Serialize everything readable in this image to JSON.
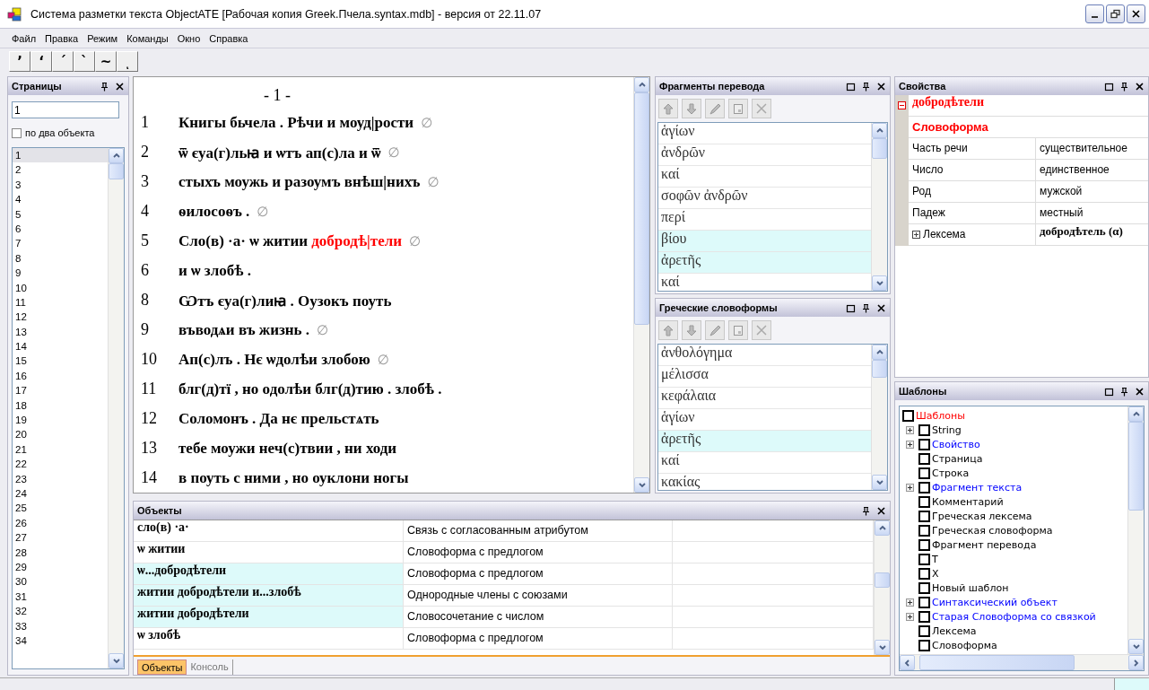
{
  "window": {
    "title": "Система разметки текста ObjectATE [Рабочая копия Greek.Пчела.syntax.mdb] -  версия от 22.11.07"
  },
  "menu": [
    "Файл",
    "Правка",
    "Режим",
    "Команды",
    "Окно",
    "Справка"
  ],
  "toolbar": [
    "’",
    "‘",
    "ˊ",
    "ˋ",
    "~",
    "ͺ"
  ],
  "pages_panel": {
    "title": "Страницы",
    "page_field": "1",
    "two_objects": {
      "label": "по два объекта",
      "checked": false
    },
    "pages": [
      {
        "label": "1",
        "selected": true
      },
      {
        "label": "2",
        "selected": false
      },
      {
        "label": "3",
        "selected": false
      },
      {
        "label": "4",
        "selected": false
      },
      {
        "label": "5",
        "selected": false
      },
      {
        "label": "6",
        "selected": false
      },
      {
        "label": "7",
        "selected": false
      },
      {
        "label": "8",
        "selected": false
      },
      {
        "label": "9",
        "selected": false
      },
      {
        "label": "10",
        "selected": false
      },
      {
        "label": "11",
        "selected": false
      },
      {
        "label": "12",
        "selected": false
      },
      {
        "label": "13",
        "selected": false
      },
      {
        "label": "14",
        "selected": false
      },
      {
        "label": "15",
        "selected": false
      },
      {
        "label": "16",
        "selected": false
      },
      {
        "label": "17",
        "selected": false
      },
      {
        "label": "18",
        "selected": false
      },
      {
        "label": "19",
        "selected": false
      },
      {
        "label": "20",
        "selected": false
      },
      {
        "label": "21",
        "selected": false
      },
      {
        "label": "22",
        "selected": false
      },
      {
        "label": "23",
        "selected": false
      },
      {
        "label": "24",
        "selected": false
      },
      {
        "label": "25",
        "selected": false
      },
      {
        "label": "26",
        "selected": false
      },
      {
        "label": "27",
        "selected": false
      },
      {
        "label": "28",
        "selected": false
      },
      {
        "label": "29",
        "selected": false
      },
      {
        "label": "30",
        "selected": false
      },
      {
        "label": "31",
        "selected": false
      },
      {
        "label": "32",
        "selected": false
      },
      {
        "label": "33",
        "selected": false
      },
      {
        "label": "34",
        "selected": false
      }
    ]
  },
  "document": {
    "page_heading": "- 1 -",
    "lines": [
      {
        "number": "1",
        "segments": [
          {
            "text": "Книгы бьчела . Рѣчи и моуд|рости",
            "highlighted": false
          }
        ],
        "mark": "∅"
      },
      {
        "number": "2",
        "segments": [
          {
            "text": "ѿ єуа(г)льꙗ и ѡтъ ап(с)ла и ѿ",
            "highlighted": false
          }
        ],
        "mark": "∅"
      },
      {
        "number": "3",
        "segments": [
          {
            "text": "стыхъ моужь и разоумъ внѣш|нихъ",
            "highlighted": false
          }
        ],
        "mark": "∅"
      },
      {
        "number": "4",
        "segments": [
          {
            "text": "ѳилосоѳъ .",
            "highlighted": false
          }
        ],
        "mark": "∅"
      },
      {
        "number": "5",
        "segments": [
          {
            "text": "Сло(в) ·а· ѡ житии ",
            "highlighted": false
          },
          {
            "text": "добродѣ|тели",
            "highlighted": true
          }
        ],
        "mark": "∅"
      },
      {
        "number": "6",
        "segments": [
          {
            "text": "и ѡ злобѣ .",
            "highlighted": false
          }
        ]
      },
      {
        "number": "8",
        "segments": [
          {
            "text": "Ѡтъ єуа(г)лиꙗ . Оузокъ поуть",
            "highlighted": false
          }
        ]
      },
      {
        "number": "9",
        "segments": [
          {
            "text": "въводѧи въ жизнь .",
            "highlighted": false
          }
        ],
        "mark": "∅"
      },
      {
        "number": "10",
        "segments": [
          {
            "text": "Ап(с)лъ . Нє ѡдолѣи злобою",
            "highlighted": false
          }
        ],
        "mark": "∅"
      },
      {
        "number": "11",
        "segments": [
          {
            "text": "блг(д)тї , но одолѣи блг(д)тию . злобѣ .",
            "highlighted": false
          }
        ]
      },
      {
        "number": "12",
        "segments": [
          {
            "text": "Соломонъ . Да нє прельстѧть",
            "highlighted": false
          }
        ]
      },
      {
        "number": "13",
        "segments": [
          {
            "text": "тебе моужи неч(с)твии , ни ходи",
            "highlighted": false
          }
        ]
      },
      {
        "number": "14",
        "segments": [
          {
            "text": "в поуть с ними , но оуклони ногы",
            "highlighted": false
          }
        ]
      }
    ]
  },
  "translation_fragments": {
    "title": "Фрагменты перевода",
    "items": [
      {
        "text": "ἁγίων",
        "selected": false
      },
      {
        "text": "ἀνδρῶν",
        "selected": false
      },
      {
        "text": "καί",
        "selected": false
      },
      {
        "text": "σοφῶν ἀνδρῶν",
        "selected": false
      },
      {
        "text": "περί",
        "selected": false
      },
      {
        "text": "βίου",
        "selected": true
      },
      {
        "text": "ἀρετῆς",
        "selected": true
      },
      {
        "text": "καί",
        "selected": false
      }
    ]
  },
  "greek_wordforms": {
    "title": "Греческие словоформы",
    "items": [
      {
        "text": "ἀνθολόγημα",
        "selected": false
      },
      {
        "text": "μέλισσα",
        "selected": false
      },
      {
        "text": "κεφάλαια",
        "selected": false
      },
      {
        "text": "ἁγίων",
        "selected": false
      },
      {
        "text": "ἀρετῆς",
        "selected": true
      },
      {
        "text": "καί",
        "selected": false
      },
      {
        "text": "κακίας",
        "selected": false
      }
    ]
  },
  "properties": {
    "title": "Свойства",
    "object": {
      "text": "добродѣтели",
      "expanded": true
    },
    "type": "Словоформа",
    "rows": [
      {
        "kind": "field",
        "name": "Часть речи",
        "value": "существительное"
      },
      {
        "kind": "field",
        "name": "Число",
        "value": "единственное"
      },
      {
        "kind": "field",
        "name": "Род",
        "value": "мужской"
      },
      {
        "kind": "field",
        "name": "Падеж",
        "value": "местный"
      },
      {
        "kind": "group",
        "name": "Лексема",
        "value": "добродѣтель (α)",
        "expanded": false
      }
    ]
  },
  "templates": {
    "title": "Шаблоны",
    "root": {
      "label": "Шаблоны",
      "checked": false,
      "color": "#ff0000",
      "children": [
        {
          "label": "String",
          "kind": "folder",
          "checked": false,
          "color": "#000000"
        },
        {
          "label": "Свойство",
          "kind": "folder",
          "checked": false,
          "color": "#0000ff"
        },
        {
          "label": "Страница",
          "kind": "leaf",
          "checked": false,
          "color": "#000000"
        },
        {
          "label": "Строка",
          "kind": "leaf",
          "checked": false,
          "color": "#000000"
        },
        {
          "label": "Фрагмент текста",
          "kind": "folder",
          "checked": false,
          "color": "#0000ff"
        },
        {
          "label": "Комментарий",
          "kind": "leaf",
          "checked": false,
          "color": "#000000"
        },
        {
          "label": "Греческая лексема",
          "kind": "leaf",
          "checked": false,
          "color": "#000000"
        },
        {
          "label": "Греческая словоформа",
          "kind": "leaf",
          "checked": false,
          "color": "#000000"
        },
        {
          "label": "Фрагмент перевода",
          "kind": "leaf",
          "checked": false,
          "color": "#000000"
        },
        {
          "label": "Т",
          "kind": "leaf",
          "checked": false,
          "color": "#000000"
        },
        {
          "label": "Х",
          "kind": "leaf",
          "checked": false,
          "color": "#000000"
        },
        {
          "label": "Новый шаблон",
          "kind": "leaf",
          "checked": false,
          "color": "#000000"
        },
        {
          "label": "Синтаксический объект",
          "kind": "folder",
          "checked": false,
          "color": "#0000ff"
        },
        {
          "label": "Старая Словоформа со связкой",
          "kind": "folder",
          "checked": false,
          "color": "#0000ff"
        },
        {
          "label": "Лексема",
          "kind": "leaf",
          "checked": false,
          "color": "#000000"
        },
        {
          "label": "Словоформа",
          "kind": "leaf",
          "checked": false,
          "color": "#000000"
        }
      ]
    }
  },
  "objects": {
    "title": "Объекты",
    "rows": [
      {
        "cells": [
          "сло(в) ·а·",
          "Связь с согласованным атрибутом"
        ],
        "selected": false
      },
      {
        "cells": [
          "ѡ житии",
          "Словоформа с предлогом"
        ],
        "selected": false
      },
      {
        "cells": [
          "ѡ...добродѣтели",
          "Словоформа с предлогом"
        ],
        "selected": true
      },
      {
        "cells": [
          "житии добродѣтели и...злобѣ",
          "Однородные члены с союзами"
        ],
        "selected": true
      },
      {
        "cells": [
          "житии добродѣтели",
          "Словосочетание с числом"
        ],
        "selected": true
      },
      {
        "cells": [
          "ѡ злобѣ",
          "Словоформа с предлогом"
        ],
        "selected": false
      }
    ]
  },
  "bottom_tabs": [
    {
      "label": "Объекты",
      "selected": true
    },
    {
      "label": "Консоль",
      "selected": false
    }
  ]
}
